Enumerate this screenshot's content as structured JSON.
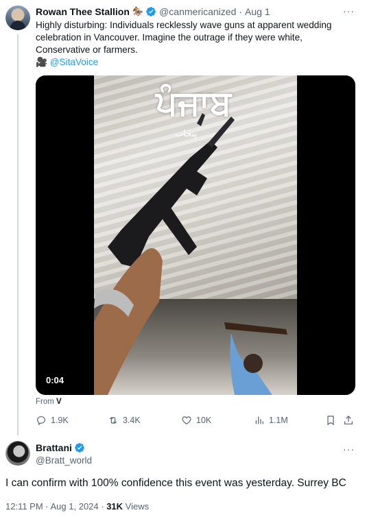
{
  "quoted_tweet": {
    "author_name": "Rowan Thee Stallion",
    "author_emoji": "🏇",
    "handle": "@canmericanized",
    "time": "Aug 1",
    "more": "···",
    "body_lines": [
      "Highly disturbing: Individuals recklessly wave guns at apparent wedding",
      "celebration in Vancouver. Imagine the outrage if they were white,",
      "Conservative or farmers."
    ],
    "credit_emoji": "🎥",
    "credit_handle": "@SitaVoice",
    "media": {
      "watermark": "ਪੰਜਾਬ",
      "watermark_sub": "پنجاب",
      "duration": "0:04"
    },
    "from_label": "From",
    "from_source": "V",
    "actions": {
      "replies": "1.9K",
      "reposts": "3.4K",
      "likes": "10K",
      "views": "1.1M"
    }
  },
  "reply_tweet": {
    "author_name": "Brattani",
    "handle": "@Bratt_world",
    "more": "···",
    "body": "I can confirm with 100% confidence this event was yesterday. Surrey BC",
    "timestamp": "12:11 PM · Aug 1, 2024 · ",
    "views_count": "31K",
    "views_label": " Views"
  },
  "colors": {
    "verified": "#1d9bf0",
    "secondary_text": "#536471",
    "link": "#1d9bf0"
  }
}
